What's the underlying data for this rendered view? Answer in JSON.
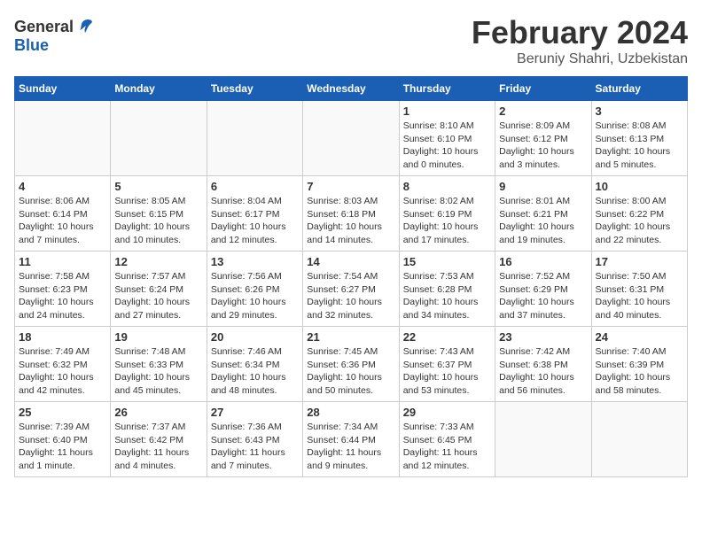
{
  "header": {
    "logo_general": "General",
    "logo_blue": "Blue",
    "title": "February 2024",
    "location": "Beruniy Shahri, Uzbekistan"
  },
  "calendar": {
    "days_of_week": [
      "Sunday",
      "Monday",
      "Tuesday",
      "Wednesday",
      "Thursday",
      "Friday",
      "Saturday"
    ],
    "weeks": [
      [
        {
          "day": "",
          "info": ""
        },
        {
          "day": "",
          "info": ""
        },
        {
          "day": "",
          "info": ""
        },
        {
          "day": "",
          "info": ""
        },
        {
          "day": "1",
          "info": "Sunrise: 8:10 AM\nSunset: 6:10 PM\nDaylight: 10 hours and 0 minutes."
        },
        {
          "day": "2",
          "info": "Sunrise: 8:09 AM\nSunset: 6:12 PM\nDaylight: 10 hours and 3 minutes."
        },
        {
          "day": "3",
          "info": "Sunrise: 8:08 AM\nSunset: 6:13 PM\nDaylight: 10 hours and 5 minutes."
        }
      ],
      [
        {
          "day": "4",
          "info": "Sunrise: 8:06 AM\nSunset: 6:14 PM\nDaylight: 10 hours and 7 minutes."
        },
        {
          "day": "5",
          "info": "Sunrise: 8:05 AM\nSunset: 6:15 PM\nDaylight: 10 hours and 10 minutes."
        },
        {
          "day": "6",
          "info": "Sunrise: 8:04 AM\nSunset: 6:17 PM\nDaylight: 10 hours and 12 minutes."
        },
        {
          "day": "7",
          "info": "Sunrise: 8:03 AM\nSunset: 6:18 PM\nDaylight: 10 hours and 14 minutes."
        },
        {
          "day": "8",
          "info": "Sunrise: 8:02 AM\nSunset: 6:19 PM\nDaylight: 10 hours and 17 minutes."
        },
        {
          "day": "9",
          "info": "Sunrise: 8:01 AM\nSunset: 6:21 PM\nDaylight: 10 hours and 19 minutes."
        },
        {
          "day": "10",
          "info": "Sunrise: 8:00 AM\nSunset: 6:22 PM\nDaylight: 10 hours and 22 minutes."
        }
      ],
      [
        {
          "day": "11",
          "info": "Sunrise: 7:58 AM\nSunset: 6:23 PM\nDaylight: 10 hours and 24 minutes."
        },
        {
          "day": "12",
          "info": "Sunrise: 7:57 AM\nSunset: 6:24 PM\nDaylight: 10 hours and 27 minutes."
        },
        {
          "day": "13",
          "info": "Sunrise: 7:56 AM\nSunset: 6:26 PM\nDaylight: 10 hours and 29 minutes."
        },
        {
          "day": "14",
          "info": "Sunrise: 7:54 AM\nSunset: 6:27 PM\nDaylight: 10 hours and 32 minutes."
        },
        {
          "day": "15",
          "info": "Sunrise: 7:53 AM\nSunset: 6:28 PM\nDaylight: 10 hours and 34 minutes."
        },
        {
          "day": "16",
          "info": "Sunrise: 7:52 AM\nSunset: 6:29 PM\nDaylight: 10 hours and 37 minutes."
        },
        {
          "day": "17",
          "info": "Sunrise: 7:50 AM\nSunset: 6:31 PM\nDaylight: 10 hours and 40 minutes."
        }
      ],
      [
        {
          "day": "18",
          "info": "Sunrise: 7:49 AM\nSunset: 6:32 PM\nDaylight: 10 hours and 42 minutes."
        },
        {
          "day": "19",
          "info": "Sunrise: 7:48 AM\nSunset: 6:33 PM\nDaylight: 10 hours and 45 minutes."
        },
        {
          "day": "20",
          "info": "Sunrise: 7:46 AM\nSunset: 6:34 PM\nDaylight: 10 hours and 48 minutes."
        },
        {
          "day": "21",
          "info": "Sunrise: 7:45 AM\nSunset: 6:36 PM\nDaylight: 10 hours and 50 minutes."
        },
        {
          "day": "22",
          "info": "Sunrise: 7:43 AM\nSunset: 6:37 PM\nDaylight: 10 hours and 53 minutes."
        },
        {
          "day": "23",
          "info": "Sunrise: 7:42 AM\nSunset: 6:38 PM\nDaylight: 10 hours and 56 minutes."
        },
        {
          "day": "24",
          "info": "Sunrise: 7:40 AM\nSunset: 6:39 PM\nDaylight: 10 hours and 58 minutes."
        }
      ],
      [
        {
          "day": "25",
          "info": "Sunrise: 7:39 AM\nSunset: 6:40 PM\nDaylight: 11 hours and 1 minute."
        },
        {
          "day": "26",
          "info": "Sunrise: 7:37 AM\nSunset: 6:42 PM\nDaylight: 11 hours and 4 minutes."
        },
        {
          "day": "27",
          "info": "Sunrise: 7:36 AM\nSunset: 6:43 PM\nDaylight: 11 hours and 7 minutes."
        },
        {
          "day": "28",
          "info": "Sunrise: 7:34 AM\nSunset: 6:44 PM\nDaylight: 11 hours and 9 minutes."
        },
        {
          "day": "29",
          "info": "Sunrise: 7:33 AM\nSunset: 6:45 PM\nDaylight: 11 hours and 12 minutes."
        },
        {
          "day": "",
          "info": ""
        },
        {
          "day": "",
          "info": ""
        }
      ]
    ]
  }
}
